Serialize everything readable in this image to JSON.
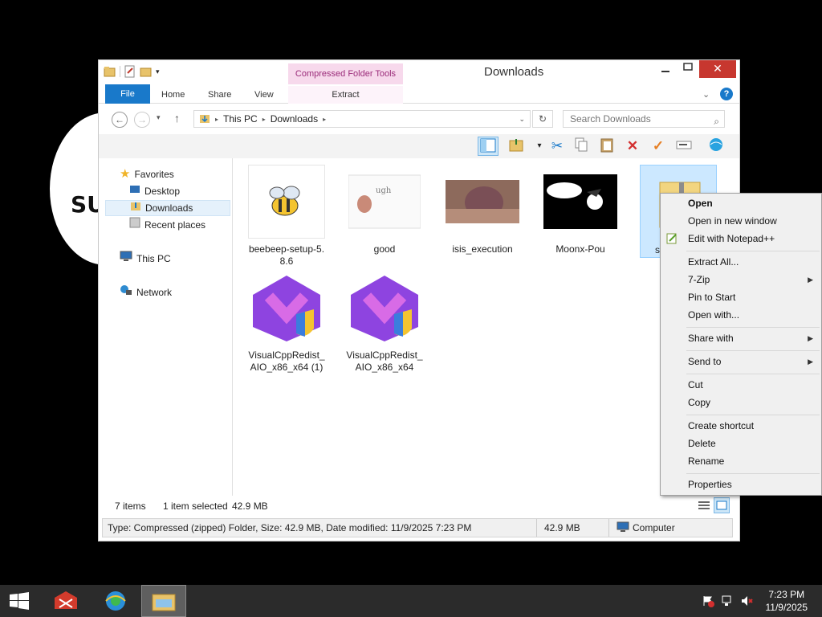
{
  "desktop": {
    "partial_text": "SU"
  },
  "window": {
    "title": "Downloads",
    "contextual_group": "Compressed Folder Tools",
    "ribbon_tabs": [
      "File",
      "Home",
      "Share",
      "View",
      "Extract"
    ],
    "address": {
      "segments": [
        "This PC",
        "Downloads"
      ]
    },
    "search": {
      "placeholder": "Search Downloads"
    }
  },
  "nav": {
    "favorites": "Favorites",
    "desktop": "Desktop",
    "downloads": "Downloads",
    "recent": "Recent places",
    "thispc": "This PC",
    "network": "Network"
  },
  "files": [
    {
      "name": "beebeep-setup-5.8.6",
      "line1": "beebeep-setup-5.",
      "line2": "8.6"
    },
    {
      "name": "good",
      "line1": "good",
      "line2": ""
    },
    {
      "name": "isis_execution",
      "line1": "isis_execution",
      "line2": ""
    },
    {
      "name": "Moonx-Pou",
      "line1": "Moonx-Pou",
      "line2": ""
    },
    {
      "name": "so",
      "line1": "so",
      "line2": ""
    },
    {
      "name": "VisualCppRedist_AIO_x86_x64 (1)",
      "line1": "VisualCppRedist_",
      "line2": "AIO_x86_x64 (1)"
    },
    {
      "name": "VisualCppRedist_AIO_x86_x64",
      "line1": "VisualCppRedist_",
      "line2": "AIO_x86_x64"
    }
  ],
  "status": {
    "items": "7 items",
    "selected": "1 item selected",
    "size": "42.9 MB",
    "details": "Type: Compressed (zipped) Folder, Size: 42.9 MB, Date modified: 11/9/2025 7:23 PM",
    "size2": "42.9 MB",
    "location": "Computer"
  },
  "context_menu": {
    "open": "Open",
    "open_new_window": "Open in new window",
    "edit_notepad": "Edit with Notepad++",
    "extract_all": "Extract All...",
    "seven_zip": "7-Zip",
    "pin_start": "Pin to Start",
    "open_with": "Open with...",
    "share_with": "Share with",
    "send_to": "Send to",
    "cut": "Cut",
    "copy": "Copy",
    "create_shortcut": "Create shortcut",
    "delete": "Delete",
    "rename": "Rename",
    "properties": "Properties"
  },
  "taskbar": {
    "time": "7:23 PM",
    "date": "11/9/2025"
  },
  "colors": {
    "accent": "#1979ca",
    "close": "#c7372f",
    "contextual": "#9b2c7a"
  }
}
